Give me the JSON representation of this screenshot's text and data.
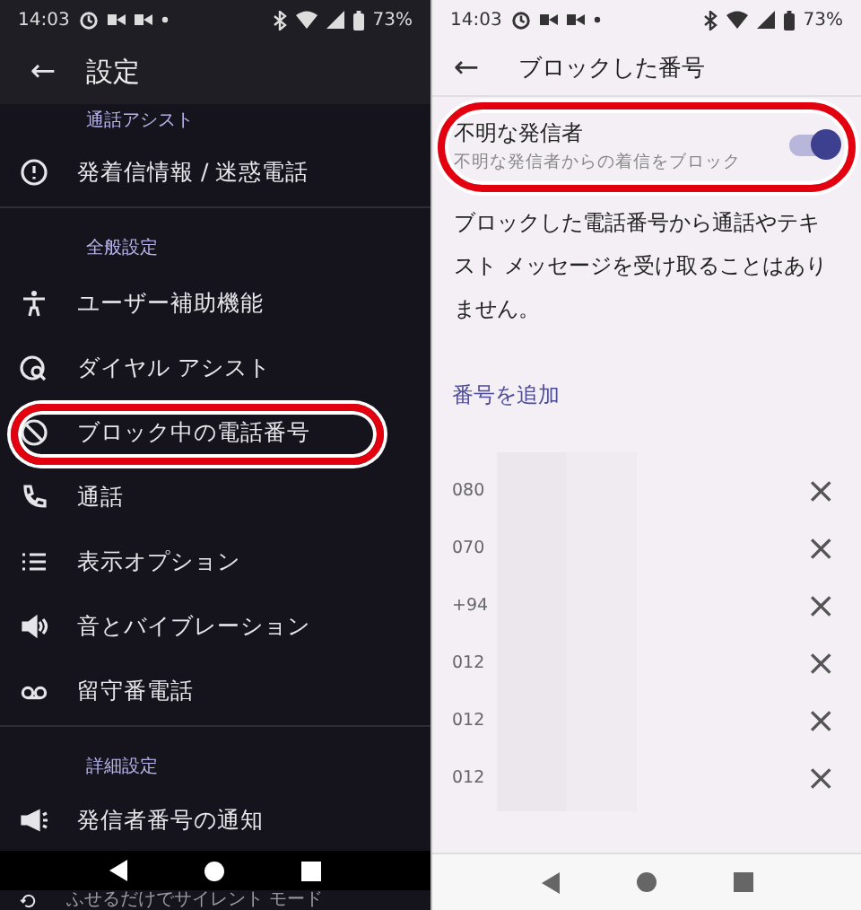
{
  "left": {
    "status_bar": {
      "time": "14:03",
      "battery": "73%"
    },
    "app_bar": {
      "back": "←",
      "title": "設定"
    },
    "items": [
      {
        "kind": "section",
        "label": "通話アシスト"
      },
      {
        "kind": "item",
        "label": "発着信情報 / 迷惑電話",
        "highlighted": false
      },
      {
        "kind": "divider"
      },
      {
        "kind": "section",
        "label": "全般設定"
      },
      {
        "kind": "item",
        "label": "ユーザー補助機能",
        "highlighted": false
      },
      {
        "kind": "item",
        "label": "ダイヤル アシスト",
        "highlighted": false
      },
      {
        "kind": "item",
        "label": "ブロック中の電話番号",
        "highlighted": true
      },
      {
        "kind": "item",
        "label": "通話",
        "highlighted": false
      },
      {
        "kind": "item",
        "label": "表示オプション",
        "highlighted": false
      },
      {
        "kind": "item",
        "label": "音とバイブレーション",
        "highlighted": false
      },
      {
        "kind": "item",
        "label": "留守番電話",
        "highlighted": false
      },
      {
        "kind": "divider"
      },
      {
        "kind": "section",
        "label": "詳細設定"
      },
      {
        "kind": "item",
        "label": "発信者番号の通知",
        "highlighted": false
      },
      {
        "kind": "item",
        "label": "ふせるだけでサイレント モード",
        "highlighted": false
      }
    ]
  },
  "right": {
    "status_bar": {
      "time": "14:03",
      "battery": "73%"
    },
    "app_bar": {
      "back": "←",
      "title": "ブロックした番号"
    },
    "unknown_callers": {
      "title": "不明な発信者",
      "subtitle": "不明な発信者からの着信をブロック",
      "on": true,
      "highlighted": true
    },
    "description": "ブロックした電話番号から通話やテキスト メッセージを受け取ることはありません。",
    "add_number": "番号を追加",
    "numbers": [
      {
        "number": "080",
        "remove": "×"
      },
      {
        "number": "070",
        "remove": "×"
      },
      {
        "number": "+94",
        "remove": "×"
      },
      {
        "number": "012",
        "remove": "×"
      },
      {
        "number": "012",
        "remove": "×"
      },
      {
        "number": "012",
        "remove": "×"
      }
    ]
  }
}
